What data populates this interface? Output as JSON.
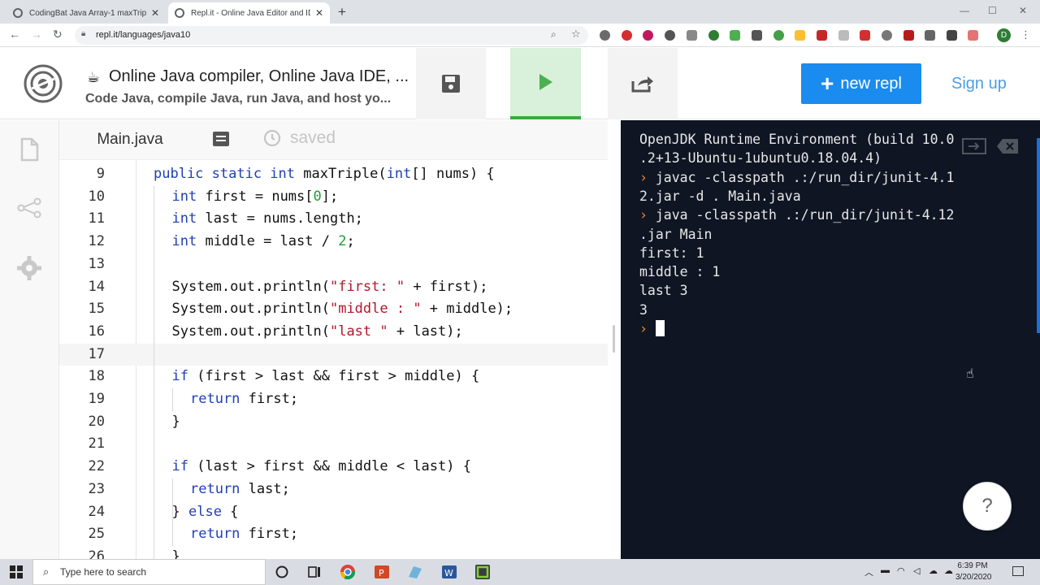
{
  "browser": {
    "tabs": [
      {
        "title": "CodingBat Java Array-1 maxTriple",
        "active": false
      },
      {
        "title": "Repl.it - Online Java Editor and IDE",
        "active": true
      }
    ],
    "url": "repl.it/languages/java10",
    "profile_initial": "D"
  },
  "header": {
    "title": "Online Java compiler, Online Java IDE, ...",
    "subtitle": "Code Java, compile Java, run Java, and host yo...",
    "new_repl_label": "new repl",
    "sign_up_label": "Sign up"
  },
  "editor": {
    "file_tab": "Main.java",
    "status": "saved",
    "current_line": 17,
    "lines": [
      {
        "n": "9",
        "indent": 0,
        "tokens": [
          [
            "kw",
            "public static int"
          ],
          [
            "t",
            " maxTriple("
          ],
          [
            "kw",
            "int"
          ],
          [
            "t",
            "[] nums) {"
          ]
        ]
      },
      {
        "n": "10",
        "indent": 1,
        "tokens": [
          [
            "kw",
            "int"
          ],
          [
            "t",
            " first = nums["
          ],
          [
            "num",
            "0"
          ],
          [
            "t",
            "];"
          ]
        ]
      },
      {
        "n": "11",
        "indent": 1,
        "tokens": [
          [
            "kw",
            "int"
          ],
          [
            "t",
            " last = nums.length;"
          ]
        ]
      },
      {
        "n": "12",
        "indent": 1,
        "tokens": [
          [
            "kw",
            "int"
          ],
          [
            "t",
            " middle = last / "
          ],
          [
            "num",
            "2"
          ],
          [
            "t",
            ";"
          ]
        ]
      },
      {
        "n": "13",
        "indent": 1,
        "tokens": []
      },
      {
        "n": "14",
        "indent": 1,
        "tokens": [
          [
            "t",
            "System.out.println("
          ],
          [
            "str",
            "\"first: \""
          ],
          [
            "t",
            " + first);"
          ]
        ]
      },
      {
        "n": "15",
        "indent": 1,
        "tokens": [
          [
            "t",
            "System.out.println("
          ],
          [
            "str",
            "\"middle : \""
          ],
          [
            "t",
            " + middle);"
          ]
        ]
      },
      {
        "n": "16",
        "indent": 1,
        "tokens": [
          [
            "t",
            "System.out.println("
          ],
          [
            "str",
            "\"last \""
          ],
          [
            "t",
            " + last);"
          ]
        ]
      },
      {
        "n": "17",
        "indent": 1,
        "tokens": []
      },
      {
        "n": "18",
        "indent": 1,
        "tokens": [
          [
            "kw",
            "if"
          ],
          [
            "t",
            " (first > last && first > middle) {"
          ]
        ]
      },
      {
        "n": "19",
        "indent": 2,
        "tokens": [
          [
            "kw",
            "return"
          ],
          [
            "t",
            " first;"
          ]
        ]
      },
      {
        "n": "20",
        "indent": 1,
        "tokens": [
          [
            "t",
            "}"
          ]
        ]
      },
      {
        "n": "21",
        "indent": 1,
        "tokens": []
      },
      {
        "n": "22",
        "indent": 1,
        "tokens": [
          [
            "kw",
            "if"
          ],
          [
            "t",
            " (last > first && middle < last) {"
          ]
        ]
      },
      {
        "n": "23",
        "indent": 2,
        "tokens": [
          [
            "kw",
            "return"
          ],
          [
            "t",
            " last;"
          ]
        ]
      },
      {
        "n": "24",
        "indent": 1,
        "tokens": [
          [
            "t",
            "} "
          ],
          [
            "kw",
            "else"
          ],
          [
            "t",
            " {"
          ]
        ]
      },
      {
        "n": "25",
        "indent": 2,
        "tokens": [
          [
            "kw",
            "return"
          ],
          [
            "t",
            " first;"
          ]
        ]
      },
      {
        "n": "26",
        "indent": 1,
        "tokens": [
          [
            "t",
            "}"
          ]
        ]
      }
    ]
  },
  "console": {
    "lines": [
      {
        "prompt": false,
        "text": "OpenJDK Runtime Environment (build 10.0"
      },
      {
        "prompt": false,
        "text": ".2+13-Ubuntu-1ubuntu0.18.04.4)"
      },
      {
        "prompt": true,
        "text": "javac -classpath .:/run_dir/junit-4.1"
      },
      {
        "prompt": false,
        "text": "2.jar -d . Main.java"
      },
      {
        "prompt": true,
        "text": "java -classpath .:/run_dir/junit-4.12"
      },
      {
        "prompt": false,
        "text": ".jar Main"
      },
      {
        "prompt": false,
        "text": "first: 1"
      },
      {
        "prompt": false,
        "text": "middle : 1"
      },
      {
        "prompt": false,
        "text": "last 3"
      },
      {
        "prompt": false,
        "text": "3"
      }
    ],
    "prompt_symbol": "›",
    "help_label": "?"
  },
  "taskbar": {
    "search_placeholder": "Type here to search",
    "time": "6:39 PM",
    "date": "3/20/2020"
  }
}
